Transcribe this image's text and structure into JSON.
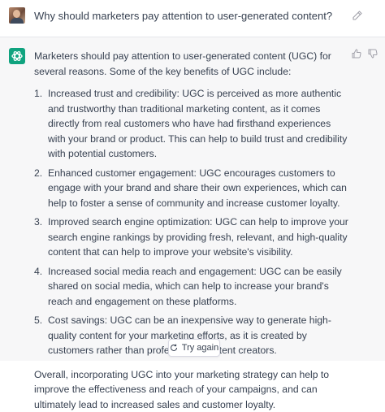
{
  "user_message": {
    "avatar_icon": "user-avatar",
    "text": "Why should marketers pay attention to user-generated content?",
    "edit_icon": "edit-icon"
  },
  "assistant_message": {
    "logo_icon": "openai-logo-icon",
    "intro": "Marketers should pay attention to user-generated content (UGC) for several reasons. Some of the key benefits of UGC include:",
    "list": [
      {
        "num": "1.",
        "text": "Increased trust and credibility: UGC is perceived as more authentic and trustworthy than traditional marketing content, as it comes directly from real customers who have had firsthand experiences with your brand or product. This can help to build trust and credibility with potential customers."
      },
      {
        "num": "2.",
        "text": "Enhanced customer engagement: UGC encourages customers to engage with your brand and share their own experiences, which can help to foster a sense of community and increase customer loyalty."
      },
      {
        "num": "3.",
        "text": "Improved search engine optimization: UGC can help to improve your search engine rankings by providing fresh, relevant, and high-quality content that can help to improve your website's visibility."
      },
      {
        "num": "4.",
        "text": "Increased social media reach and engagement: UGC can be easily shared on social media, which can help to increase your brand's reach and engagement on these platforms."
      },
      {
        "num": "5.",
        "text": "Cost savings: UGC can be an inexpensive way to generate high-quality content for your marketing efforts, as it is created by customers rather than professional content creators."
      }
    ],
    "conclusion": "Overall, incorporating UGC into your marketing strategy can help to improve the effectiveness and reach of your campaigns, and can ultimately lead to increased sales and customer loyalty.",
    "thumbs_up_icon": "thumbs-up-icon",
    "thumbs_down_icon": "thumbs-down-icon"
  },
  "retry_button": {
    "label": "Try again",
    "icon": "refresh-icon"
  },
  "colors": {
    "assistant_bg": "#f7f7f8",
    "brand": "#10a37f",
    "text": "#374151"
  }
}
